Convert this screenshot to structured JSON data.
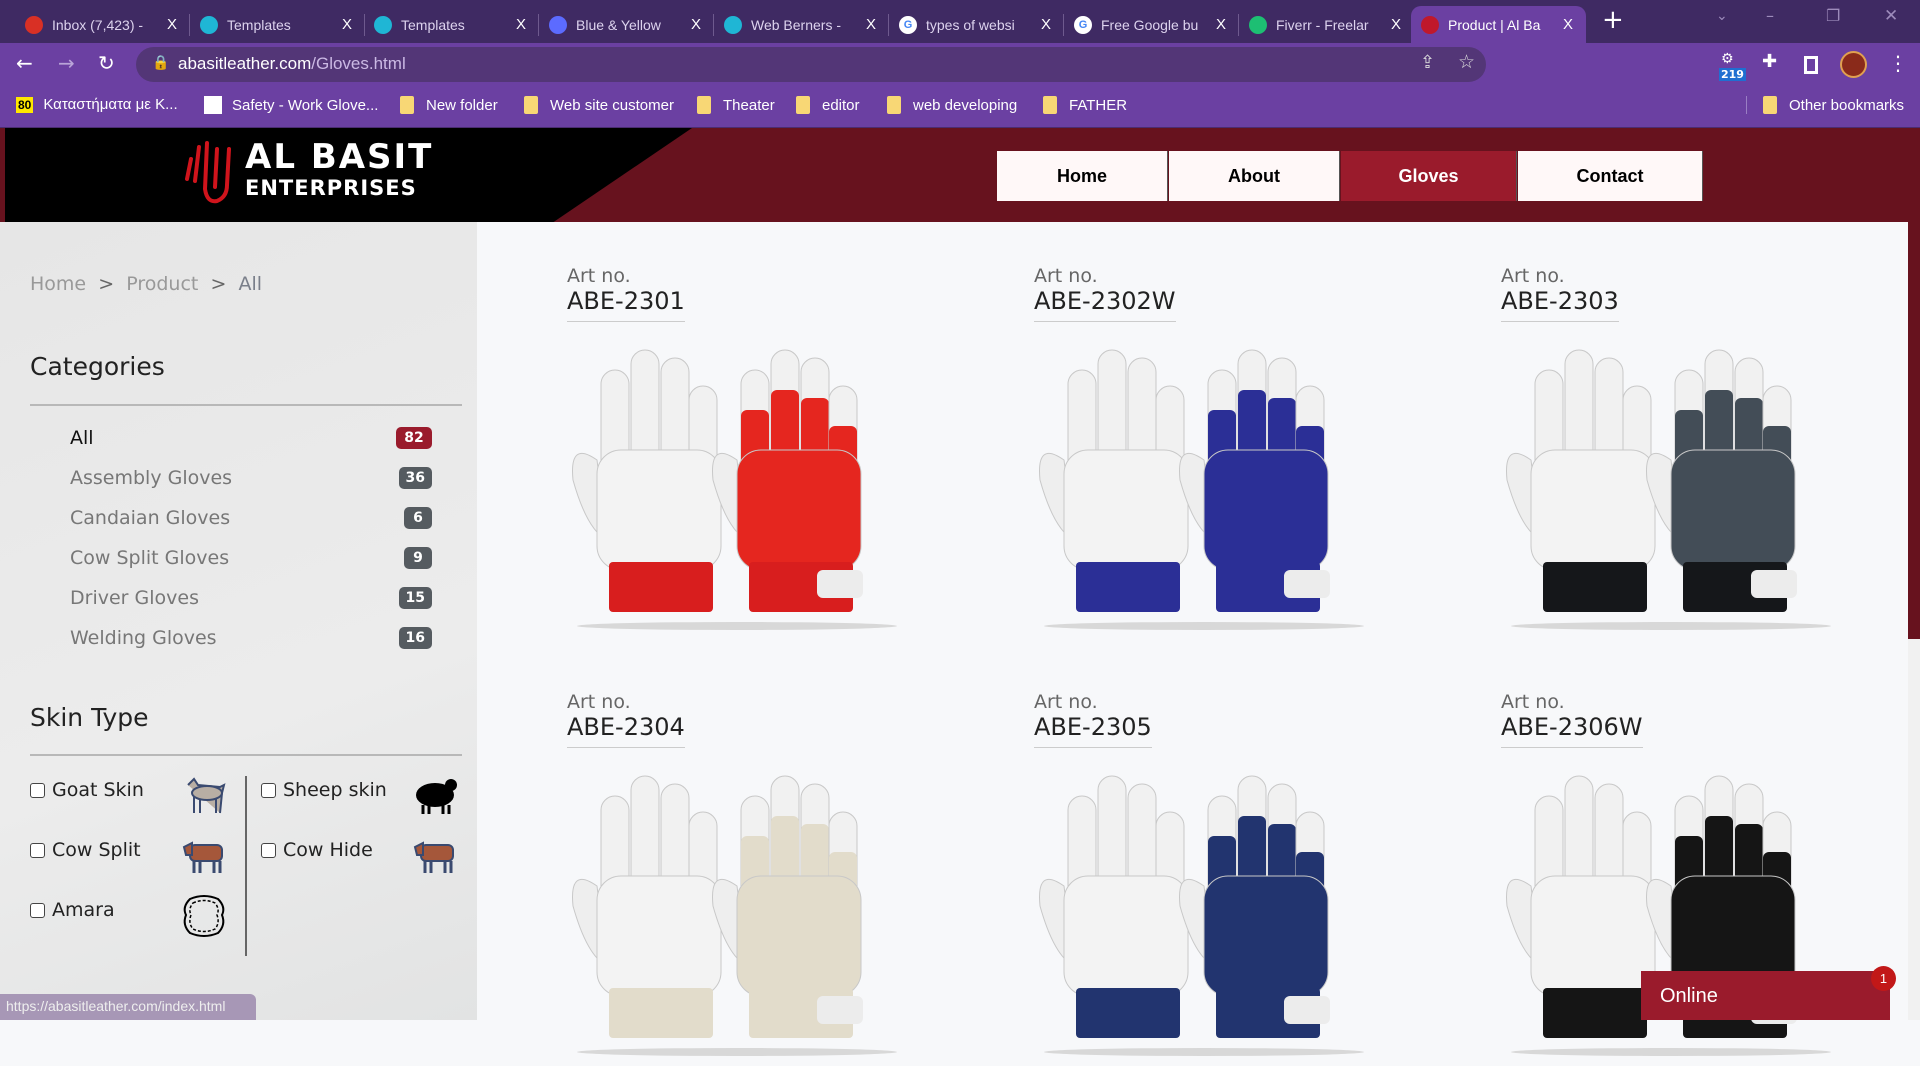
{
  "browser": {
    "tabs": [
      {
        "title": "Inbox (7,423) -",
        "icon": "gmail-icon",
        "color": "#d93025"
      },
      {
        "title": "Templates",
        "icon": "canva-icon",
        "color": "#1fb6d5"
      },
      {
        "title": "Templates",
        "icon": "canva-icon",
        "color": "#1fb6d5"
      },
      {
        "title": "Blue & Yellow",
        "icon": "heart-chat-icon",
        "color": "#5c6bff"
      },
      {
        "title": "Web Berners -",
        "icon": "canva-icon",
        "color": "#1fb6d5"
      },
      {
        "title": "types of websi",
        "icon": "google-icon",
        "color": "#ffffff"
      },
      {
        "title": "Free Google bu",
        "icon": "google-icon",
        "color": "#ffffff"
      },
      {
        "title": "Fiverr - Freelar",
        "icon": "fiverr-icon",
        "color": "#1dbf73"
      },
      {
        "title": "Product | Al Ba",
        "icon": "albasit-hand-icon",
        "color": "#c0182b",
        "active": true
      }
    ],
    "close_glyph": "X",
    "new_tab_glyph": "+",
    "url_domain": "abasitleather.com",
    "url_path": "/Gloves.html",
    "extension_badge": "219",
    "bookmarks": [
      {
        "label": "Καταστήματα με Κ...",
        "icon": "80-icon"
      },
      {
        "label": "Safety - Work Glove...",
        "icon": "safety-icon"
      },
      {
        "label": "New folder",
        "icon": "folder-icon"
      },
      {
        "label": "Web site customer",
        "icon": "folder-icon"
      },
      {
        "label": "Theater",
        "icon": "folder-icon"
      },
      {
        "label": "editor",
        "icon": "folder-icon"
      },
      {
        "label": "web developing",
        "icon": "folder-icon"
      },
      {
        "label": "FATHER",
        "icon": "folder-icon"
      }
    ],
    "other_bookmarks": "Other bookmarks",
    "status_url": "https://abasitleather.com/index.html"
  },
  "site": {
    "logo_line1": "AL BASIT",
    "logo_line2": "ENTERPRISES",
    "brand_color": "#9a1b2c",
    "nav": [
      {
        "label": "Home"
      },
      {
        "label": "About"
      },
      {
        "label": "Gloves",
        "active": true
      },
      {
        "label": "Contact"
      }
    ],
    "breadcrumb": [
      "Home",
      "Product",
      "All"
    ],
    "breadcrumb_sep": ">",
    "categories_title": "Categories",
    "categories": [
      {
        "label": "All",
        "count": "82",
        "active": true
      },
      {
        "label": "Assembly Gloves",
        "count": "36"
      },
      {
        "label": "Candaian Gloves",
        "count": "6"
      },
      {
        "label": "Cow Split Gloves",
        "count": "9"
      },
      {
        "label": "Driver Gloves",
        "count": "15"
      },
      {
        "label": "Welding Gloves",
        "count": "16"
      }
    ],
    "skin_title": "Skin Type",
    "skins": [
      {
        "label": "Goat Skin",
        "icon": "goat-icon",
        "checked": false
      },
      {
        "label": "Sheep skin",
        "icon": "sheep-icon",
        "checked": false
      },
      {
        "label": "Cow Split",
        "icon": "cow-icon",
        "checked": false
      },
      {
        "label": "Cow Hide",
        "icon": "cow-icon",
        "checked": false
      },
      {
        "label": "Amara",
        "icon": "leather-hide-icon",
        "checked": false
      }
    ],
    "products": [
      {
        "art_label": "Art no.",
        "code": "ABE-2301",
        "fabric": "#e5261f",
        "cuff": "#d81e1e"
      },
      {
        "art_label": "Art no.",
        "code": "ABE-2302W",
        "fabric": "#2b2f96",
        "cuff": "#2b2f96"
      },
      {
        "art_label": "Art no.",
        "code": "ABE-2303",
        "fabric": "#434d57",
        "cuff": "#15171a"
      },
      {
        "art_label": "Art no.",
        "code": "ABE-2304",
        "fabric": "#e2dccb",
        "cuff": "#e2dccb"
      },
      {
        "art_label": "Art no.",
        "code": "ABE-2305",
        "fabric": "#22346f",
        "cuff": "#22346f"
      },
      {
        "art_label": "Art no.",
        "code": "ABE-2306W",
        "fabric": "#151515",
        "cuff": "#151515"
      }
    ],
    "chat_label": "Online",
    "chat_badge": "1"
  }
}
